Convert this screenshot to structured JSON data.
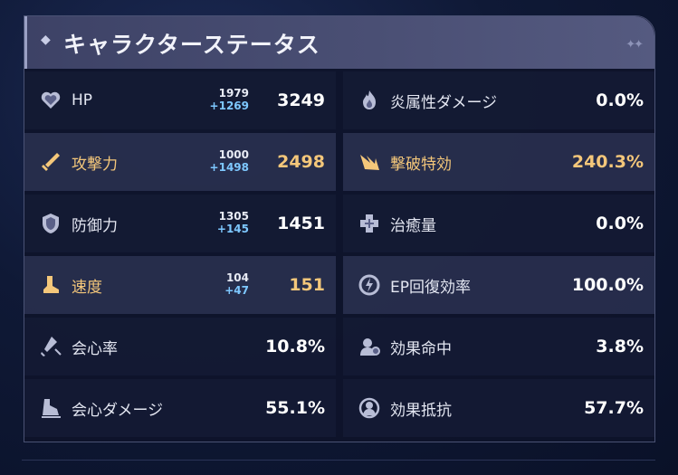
{
  "title": "キャラクターステータス",
  "left": [
    {
      "icon": "heart-icon",
      "label": "HP",
      "base": "1979",
      "bonus": "+1269",
      "value": "3249",
      "highlight": false
    },
    {
      "icon": "sword-icon",
      "label": "攻撃力",
      "base": "1000",
      "bonus": "+1498",
      "value": "2498",
      "highlight": true
    },
    {
      "icon": "shield-icon",
      "label": "防御力",
      "base": "1305",
      "bonus": "+145",
      "value": "1451",
      "highlight": false
    },
    {
      "icon": "boot-icon",
      "label": "速度",
      "base": "104",
      "bonus": "+47",
      "value": "151",
      "highlight": true
    },
    {
      "icon": "crit-rate-icon",
      "label": "会心率",
      "base": "",
      "bonus": "",
      "value": "10.8%",
      "highlight": false
    },
    {
      "icon": "crit-damage-icon",
      "label": "会心ダメージ",
      "base": "",
      "bonus": "",
      "value": "55.1%",
      "highlight": false
    }
  ],
  "right": [
    {
      "icon": "fire-damage-icon",
      "label": "炎属性ダメージ",
      "value": "0.0%",
      "highlight": false
    },
    {
      "icon": "break-effect-icon",
      "label": "撃破特効",
      "value": "240.3%",
      "highlight": true
    },
    {
      "icon": "healing-icon",
      "label": "治癒量",
      "value": "0.0%",
      "highlight": false
    },
    {
      "icon": "energy-regen-icon",
      "label": "EP回復効率",
      "value": "100.0%",
      "highlight": false
    },
    {
      "icon": "effect-hit-icon",
      "label": "効果命中",
      "value": "3.8%",
      "highlight": false
    },
    {
      "icon": "effect-res-icon",
      "label": "効果抵抗",
      "value": "57.7%",
      "highlight": false
    }
  ]
}
